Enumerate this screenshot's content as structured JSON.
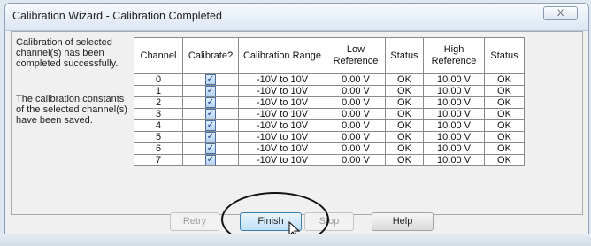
{
  "window": {
    "title": "Calibration Wizard - Calibration Completed",
    "close_glyph": "X"
  },
  "messages": {
    "completed": "Calibration of selected channel(s) has been completed successfully.",
    "saved": "The calibration constants of the selected channel(s) have been saved."
  },
  "table": {
    "headers": [
      "Channel",
      "Calibrate?",
      "Calibration Range",
      "Low Reference",
      "Status",
      "High Reference",
      "Status"
    ],
    "rows": [
      {
        "channel": "0",
        "calibrate": true,
        "range": "-10V to 10V",
        "low": "0.00 V",
        "low_status": "OK",
        "high": "10.00 V",
        "high_status": "OK"
      },
      {
        "channel": "1",
        "calibrate": true,
        "range": "-10V to 10V",
        "low": "0.00 V",
        "low_status": "OK",
        "high": "10.00 V",
        "high_status": "OK"
      },
      {
        "channel": "2",
        "calibrate": true,
        "range": "-10V to 10V",
        "low": "0.00 V",
        "low_status": "OK",
        "high": "10.00 V",
        "high_status": "OK"
      },
      {
        "channel": "3",
        "calibrate": true,
        "range": "-10V to 10V",
        "low": "0.00 V",
        "low_status": "OK",
        "high": "10.00 V",
        "high_status": "OK"
      },
      {
        "channel": "4",
        "calibrate": true,
        "range": "-10V to 10V",
        "low": "0.00 V",
        "low_status": "OK",
        "high": "10.00 V",
        "high_status": "OK"
      },
      {
        "channel": "5",
        "calibrate": true,
        "range": "-10V to 10V",
        "low": "0.00 V",
        "low_status": "OK",
        "high": "10.00 V",
        "high_status": "OK"
      },
      {
        "channel": "6",
        "calibrate": true,
        "range": "-10V to 10V",
        "low": "0.00 V",
        "low_status": "OK",
        "high": "10.00 V",
        "high_status": "OK"
      },
      {
        "channel": "7",
        "calibrate": true,
        "range": "-10V to 10V",
        "low": "0.00 V",
        "low_status": "OK",
        "high": "10.00 V",
        "high_status": "OK"
      }
    ]
  },
  "buttons": {
    "retry": {
      "label": "Retry",
      "enabled": false
    },
    "finish": {
      "label": "Finish",
      "enabled": true
    },
    "stop": {
      "label": "Stop",
      "enabled": false
    },
    "help": {
      "label": "Help",
      "enabled": true
    }
  },
  "icons": {
    "checkbox": "checkmark-icon",
    "cursor": "arrow-cursor-icon"
  }
}
